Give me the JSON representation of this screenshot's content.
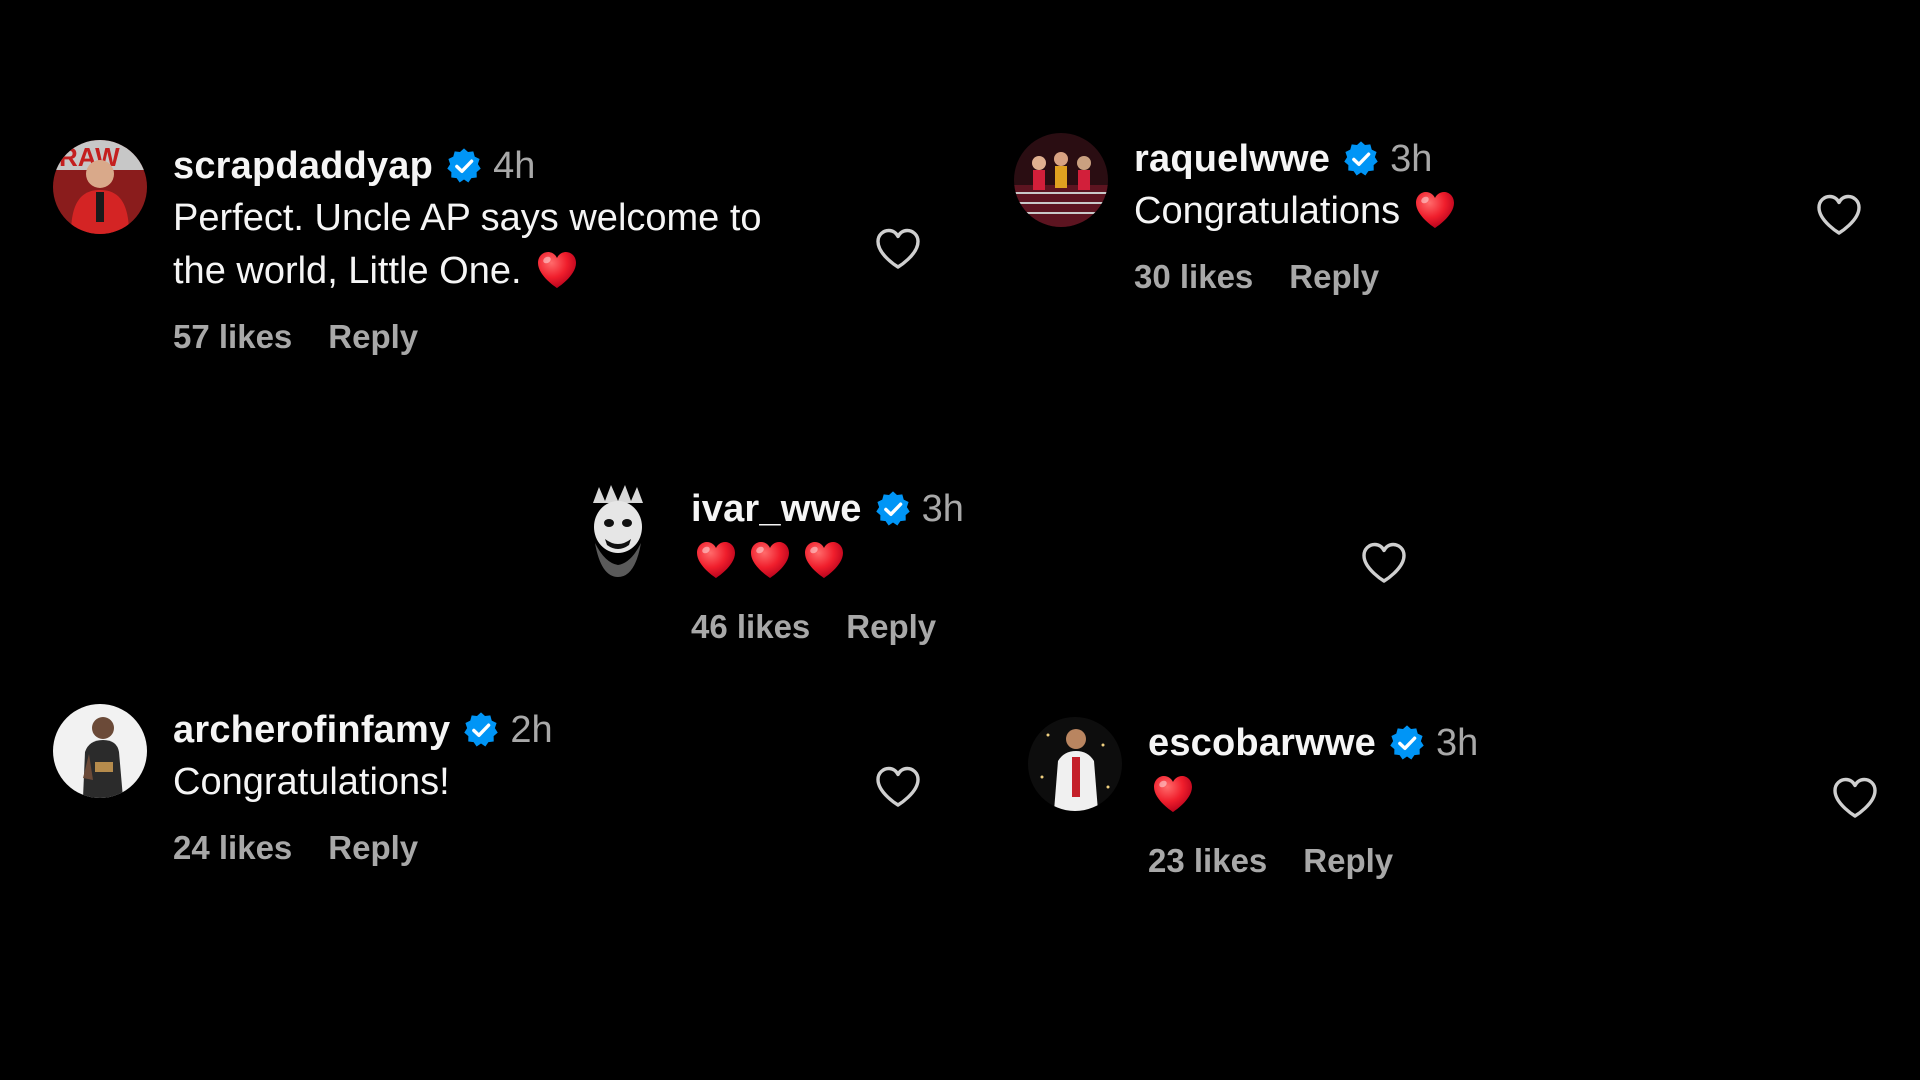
{
  "colors": {
    "background": "#000000",
    "text_primary": "#f5f5f5",
    "text_secondary": "#a8a8a8",
    "verified_blue": "#0095f6",
    "heart_red": "#ff3040"
  },
  "comments": [
    {
      "username": "scrapdaddyap",
      "verified": true,
      "time": "4h",
      "text_lines": [
        "Perfect. Uncle AP says welcome to",
        "the world, Little One."
      ],
      "emoji": "red-heart",
      "likes": "57 likes",
      "reply": "Reply",
      "like_icon": "heart-outline-icon"
    },
    {
      "username": "raquelwwe",
      "verified": true,
      "time": "3h",
      "text_lines": [
        "Congratulations"
      ],
      "emoji": "red-heart",
      "likes": "30 likes",
      "reply": "Reply",
      "like_icon": "heart-outline-icon"
    },
    {
      "username": "ivar_wwe",
      "verified": true,
      "time": "3h",
      "text_lines": [],
      "emoji": "red-heart x3",
      "likes": "46 likes",
      "reply": "Reply",
      "like_icon": "heart-outline-icon"
    },
    {
      "username": "archerofinfamy",
      "verified": true,
      "time": "2h",
      "text_lines": [
        "Congratulations!"
      ],
      "likes": "24 likes",
      "reply": "Reply",
      "like_icon": "heart-outline-icon"
    },
    {
      "username": "escobarwwe",
      "verified": true,
      "time": "3h",
      "text_lines": [],
      "emoji": "red-heart",
      "likes": "23 likes",
      "reply": "Reply",
      "like_icon": "heart-outline-icon"
    }
  ]
}
